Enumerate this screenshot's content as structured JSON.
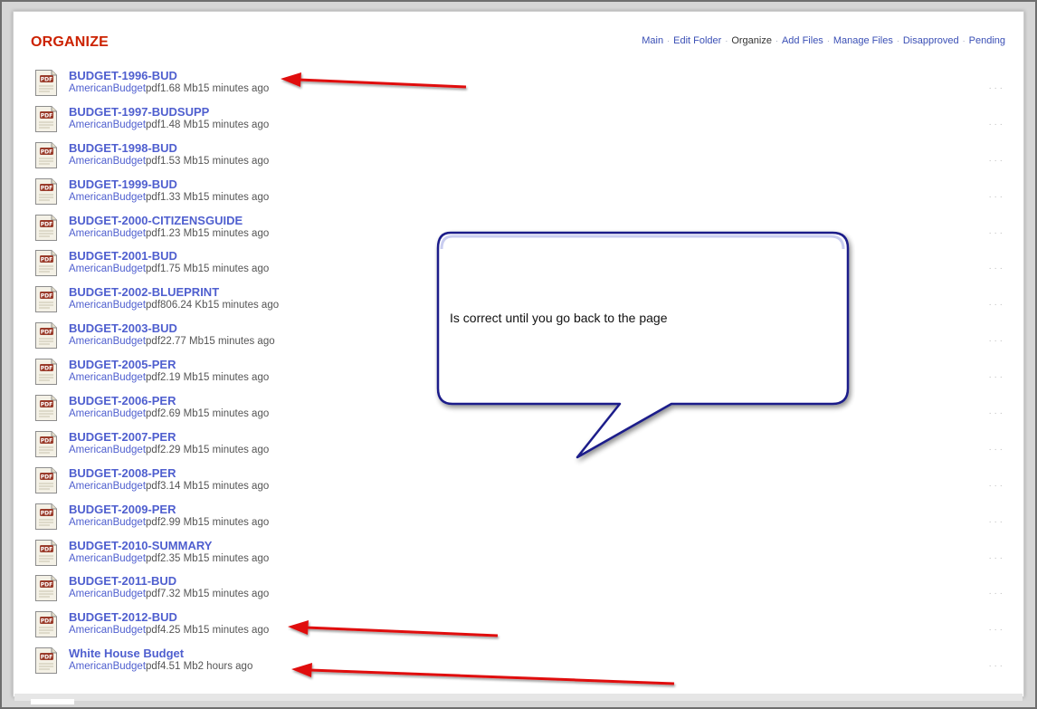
{
  "page": {
    "title": "ORGANIZE"
  },
  "nav": {
    "items": [
      {
        "label": "Main",
        "current": false
      },
      {
        "label": "Edit Folder",
        "current": false
      },
      {
        "label": "Organize",
        "current": true
      },
      {
        "label": "Add Files",
        "current": false
      },
      {
        "label": "Manage Files",
        "current": false
      },
      {
        "label": "Disapproved",
        "current": false
      },
      {
        "label": "Pending",
        "current": false
      }
    ]
  },
  "files": [
    {
      "name": "BUDGET-1996-BUD",
      "author": "AmericanBudget",
      "type": "pdf",
      "size": "1.68 Mb",
      "time": "15 minutes ago"
    },
    {
      "name": "BUDGET-1997-BUDSUPP",
      "author": "AmericanBudget",
      "type": "pdf",
      "size": "1.48 Mb",
      "time": "15 minutes ago"
    },
    {
      "name": "BUDGET-1998-BUD",
      "author": "AmericanBudget",
      "type": "pdf",
      "size": "1.53 Mb",
      "time": "15 minutes ago"
    },
    {
      "name": "BUDGET-1999-BUD",
      "author": "AmericanBudget",
      "type": "pdf",
      "size": "1.33 Mb",
      "time": "15 minutes ago"
    },
    {
      "name": "BUDGET-2000-CITIZENSGUIDE",
      "author": "AmericanBudget",
      "type": "pdf",
      "size": "1.23 Mb",
      "time": "15 minutes ago"
    },
    {
      "name": "BUDGET-2001-BUD",
      "author": "AmericanBudget",
      "type": "pdf",
      "size": "1.75 Mb",
      "time": "15 minutes ago"
    },
    {
      "name": "BUDGET-2002-BLUEPRINT",
      "author": "AmericanBudget",
      "type": "pdf",
      "size": "806.24 Kb",
      "time": "15 minutes ago"
    },
    {
      "name": "BUDGET-2003-BUD",
      "author": "AmericanBudget",
      "type": "pdf",
      "size": "22.77 Mb",
      "time": "15 minutes ago"
    },
    {
      "name": "BUDGET-2005-PER",
      "author": "AmericanBudget",
      "type": "pdf",
      "size": "2.19 Mb",
      "time": "15 minutes ago"
    },
    {
      "name": "BUDGET-2006-PER",
      "author": "AmericanBudget",
      "type": "pdf",
      "size": "2.69 Mb",
      "time": "15 minutes ago"
    },
    {
      "name": "BUDGET-2007-PER",
      "author": "AmericanBudget",
      "type": "pdf",
      "size": "2.29 Mb",
      "time": "15 minutes ago"
    },
    {
      "name": "BUDGET-2008-PER",
      "author": "AmericanBudget",
      "type": "pdf",
      "size": "3.14 Mb",
      "time": "15 minutes ago"
    },
    {
      "name": "BUDGET-2009-PER",
      "author": "AmericanBudget",
      "type": "pdf",
      "size": "2.99 Mb",
      "time": "15 minutes ago"
    },
    {
      "name": "BUDGET-2010-SUMMARY",
      "author": "AmericanBudget",
      "type": "pdf",
      "size": "2.35 Mb",
      "time": "15 minutes ago"
    },
    {
      "name": "BUDGET-2011-BUD",
      "author": "AmericanBudget",
      "type": "pdf",
      "size": "7.32 Mb",
      "time": "15 minutes ago"
    },
    {
      "name": "BUDGET-2012-BUD",
      "author": "AmericanBudget",
      "type": "pdf",
      "size": "4.25 Mb",
      "time": "15 minutes ago"
    },
    {
      "name": "White House Budget",
      "author": "AmericanBudget",
      "type": "pdf",
      "size": "4.51 Mb",
      "time": "2 hours ago"
    }
  ],
  "file_icon": {
    "name": "pdf-file-icon",
    "badge": "PDF"
  },
  "row_dots": "· · ·",
  "annotation": {
    "callout_text": "Is correct until you go back to the page",
    "colors": {
      "arrow": "#e01010",
      "callout_border": "#1a1f8a",
      "callout_fill": "#ffffff"
    }
  },
  "colors": {
    "title": "#cc2200",
    "link": "#4f5fcf",
    "nav_link": "#3a4fb5",
    "meta_text": "#555555"
  }
}
